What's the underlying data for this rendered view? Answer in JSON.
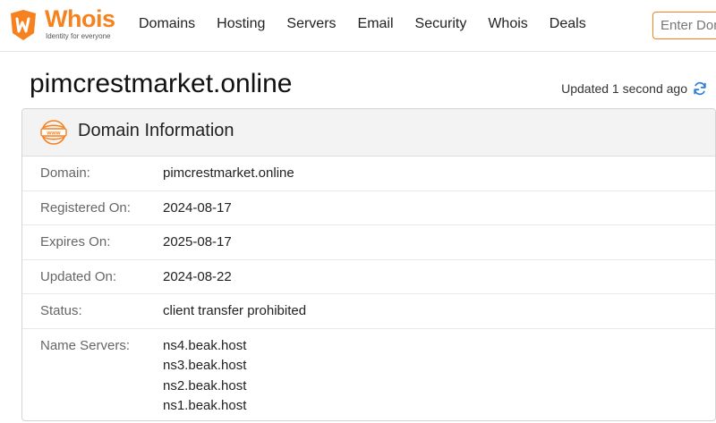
{
  "header": {
    "logo_text": "Whois",
    "logo_tagline": "Identity for everyone",
    "nav": [
      "Domains",
      "Hosting",
      "Servers",
      "Email",
      "Security",
      "Whois",
      "Deals"
    ],
    "search_placeholder": "Enter Domain"
  },
  "page": {
    "title": "pimcrestmarket.online",
    "updated_text": "Updated 1 second ago"
  },
  "card": {
    "title": "Domain Information",
    "rows": [
      {
        "label": "Domain:",
        "value": "pimcrestmarket.online"
      },
      {
        "label": "Registered On:",
        "value": "2024-08-17"
      },
      {
        "label": "Expires On:",
        "value": "2025-08-17"
      },
      {
        "label": "Updated On:",
        "value": "2024-08-22"
      },
      {
        "label": "Status:",
        "value": "client transfer prohibited"
      }
    ],
    "name_servers": {
      "label": "Name Servers:",
      "values": [
        "ns4.beak.host",
        "ns3.beak.host",
        "ns2.beak.host",
        "ns1.beak.host"
      ]
    }
  },
  "icons": {
    "logo": "whois-logo-icon",
    "refresh": "refresh-icon",
    "www": "www-globe-icon"
  },
  "colors": {
    "brand": "#f5821f",
    "refresh": "#2f7fd8"
  }
}
